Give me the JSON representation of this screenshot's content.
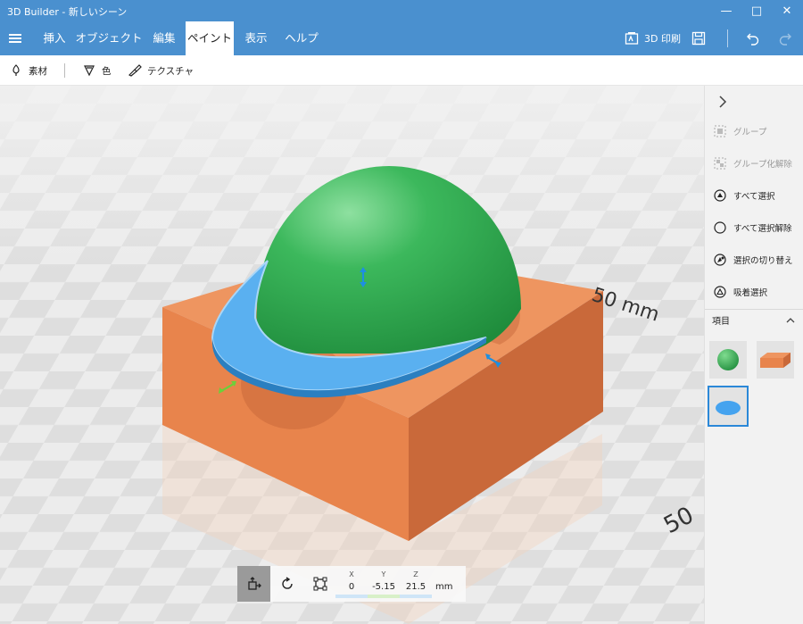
{
  "app": {
    "title": "3D Builder - 新しいシーン"
  },
  "window": {
    "minimize": "—",
    "maximize": "□",
    "close": "✕"
  },
  "tabs": [
    {
      "label": "挿入"
    },
    {
      "label": "オブジェクト"
    },
    {
      "label": "編集"
    },
    {
      "label": "ペイント",
      "active": true
    },
    {
      "label": "表示"
    },
    {
      "label": "ヘルプ"
    }
  ],
  "toolbar_right": {
    "print_label": "3D 印刷"
  },
  "paint_tools": [
    {
      "label": "素材",
      "icon": "material-icon"
    },
    {
      "label": "色",
      "icon": "color-icon"
    },
    {
      "label": "テクスチャ",
      "icon": "texture-icon"
    }
  ],
  "viewport": {
    "ruler_label_right": "50 mm",
    "ruler_label_bottom": "50"
  },
  "right_panel": {
    "actions": [
      {
        "label": "グループ",
        "enabled": false,
        "icon": "group-icon"
      },
      {
        "label": "グループ化解除",
        "enabled": false,
        "icon": "ungroup-icon"
      },
      {
        "label": "すべて選択",
        "enabled": true,
        "icon": "select-all-icon"
      },
      {
        "label": "すべて選択解除",
        "enabled": true,
        "icon": "deselect-all-icon"
      },
      {
        "label": "選択の切り替え",
        "enabled": true,
        "icon": "toggle-selection-icon"
      },
      {
        "label": "吸着選択",
        "enabled": true,
        "icon": "snap-select-icon"
      }
    ],
    "items_header": "項目",
    "items": [
      {
        "name": "sphere",
        "color": "#2ea44f"
      },
      {
        "name": "box",
        "color": "#ee8a4f"
      },
      {
        "name": "disc",
        "color": "#45a3ef",
        "selected": true
      }
    ]
  },
  "gizmo": {
    "x_label": "X",
    "x_value": "0",
    "y_label": "Y",
    "y_value": "-5.15",
    "z_label": "Z",
    "z_value": "21.5",
    "unit": "mm"
  },
  "colors": {
    "accent": "#4a90cf",
    "box_front": "#e8844c",
    "box_top": "#ee9560",
    "sphere": "#2ea44f",
    "disc": "#5ab0f0",
    "selection_blue": "#2b88d8"
  }
}
